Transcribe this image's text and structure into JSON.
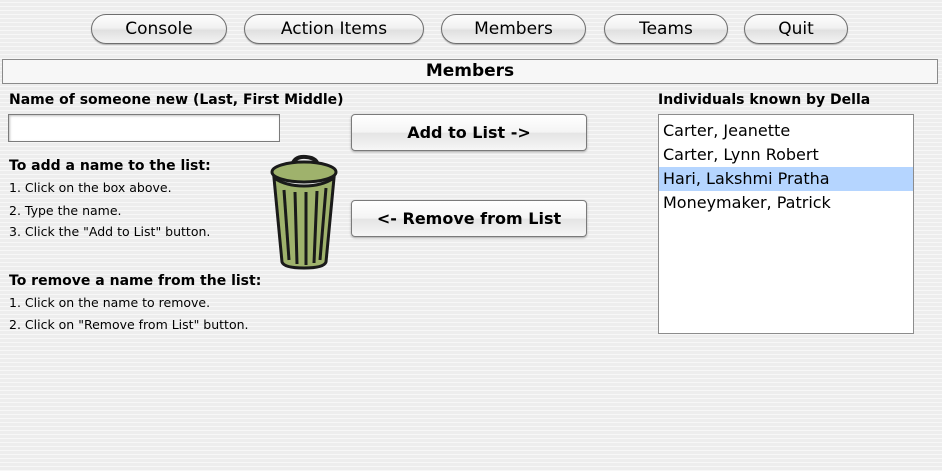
{
  "toolbar": {
    "buttons": [
      "Console",
      "Action Items",
      "Members",
      "Teams",
      "Quit"
    ]
  },
  "page": {
    "title": "Members"
  },
  "new_name": {
    "label": "Name of someone new (Last, First Middle)",
    "value": ""
  },
  "add_instructions": {
    "heading": "To add a name to the list:",
    "steps": [
      "1. Click on the box above.",
      "2. Type the name.",
      "3. Click the \"Add to List\" button."
    ]
  },
  "remove_instructions": {
    "heading": "To remove a name from the list:",
    "steps": [
      "1. Click on the name to remove.",
      "2. Click on \"Remove from List\" button."
    ]
  },
  "actions": {
    "add_label": "Add to List ->",
    "remove_label": "<- Remove from List"
  },
  "known_list": {
    "label": "Individuals known by Della",
    "items": [
      "Carter, Jeanette",
      "Carter, Lynn Robert",
      "Hari, Lakshmi Pratha",
      "Moneymaker, Patrick"
    ],
    "selected_index": 2,
    "selection_color": "#b5d5ff"
  },
  "icons": {
    "trash": "trash-can-icon"
  },
  "colors": {
    "trash_fill": "#9fb26c",
    "trash_outline": "#1a1a1a"
  }
}
